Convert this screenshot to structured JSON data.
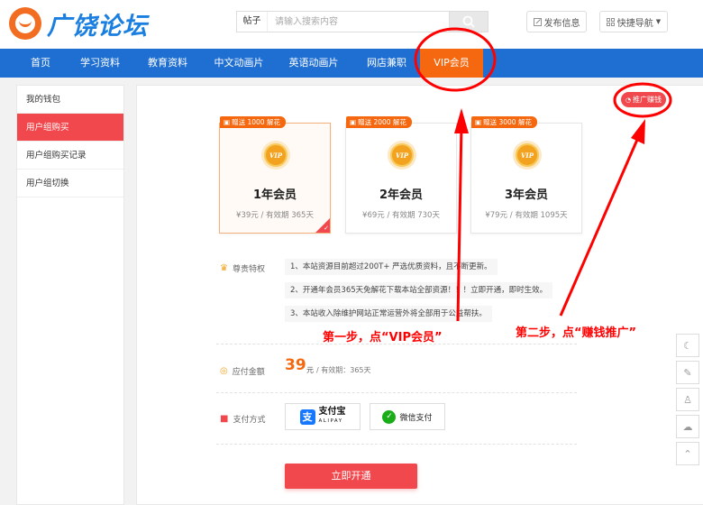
{
  "header": {
    "logo_text": "广饶论坛",
    "search_category": "帖子",
    "search_placeholder": "请输入搜索内容",
    "post_button": "发布信息",
    "quick_nav": "快捷导航"
  },
  "nav": {
    "items": [
      "首页",
      "学习资料",
      "教育资料",
      "中文动画片",
      "英语动画片",
      "网店兼职",
      "VIP会员"
    ]
  },
  "sidebar": {
    "title": "我的钱包",
    "items": [
      "用户组购买",
      "用户组购买记录",
      "用户组切换"
    ]
  },
  "main": {
    "promo_button": "推广赚钱",
    "plans": [
      {
        "tag": "赠送 1000 解花",
        "title": "1年会员",
        "price": "¥39元 / 有效期 365天"
      },
      {
        "tag": "赠送 2000 解花",
        "title": "2年会员",
        "price": "¥69元 / 有效期 730天"
      },
      {
        "tag": "赠送 3000 解花",
        "title": "3年会员",
        "price": "¥79元 / 有效期 1095天"
      }
    ],
    "vip_badge": "VIP",
    "privileges_label": "尊贵特权",
    "benefits": [
      "1、本站资源目前超过200T+ 严选优质资料，且不断更新。",
      "2、开通年会员365天免解花下载本站全部资源！！！立即开通，即时生效。",
      "3、本站收入除维护网站正常运营外将全部用于公益帮扶。"
    ],
    "amount_label": "应付金额",
    "amount_value": "39",
    "amount_unit": "元",
    "amount_note": "/ 有效期：365天",
    "pay_label": "支付方式",
    "alipay_cn": "支付宝",
    "alipay_en": "ALIPAY",
    "wechat_pay": "微信支付",
    "open_button": "立即开通"
  },
  "annotations": {
    "step1": "第一步，点“VIP会员”",
    "step2": "第二步，点“赚钱推广”"
  },
  "colors": {
    "nav_blue": "#1f6fd2",
    "accent_orange": "#f5680f",
    "accent_red": "#f0484d",
    "annotation_red": "#ff0000"
  }
}
